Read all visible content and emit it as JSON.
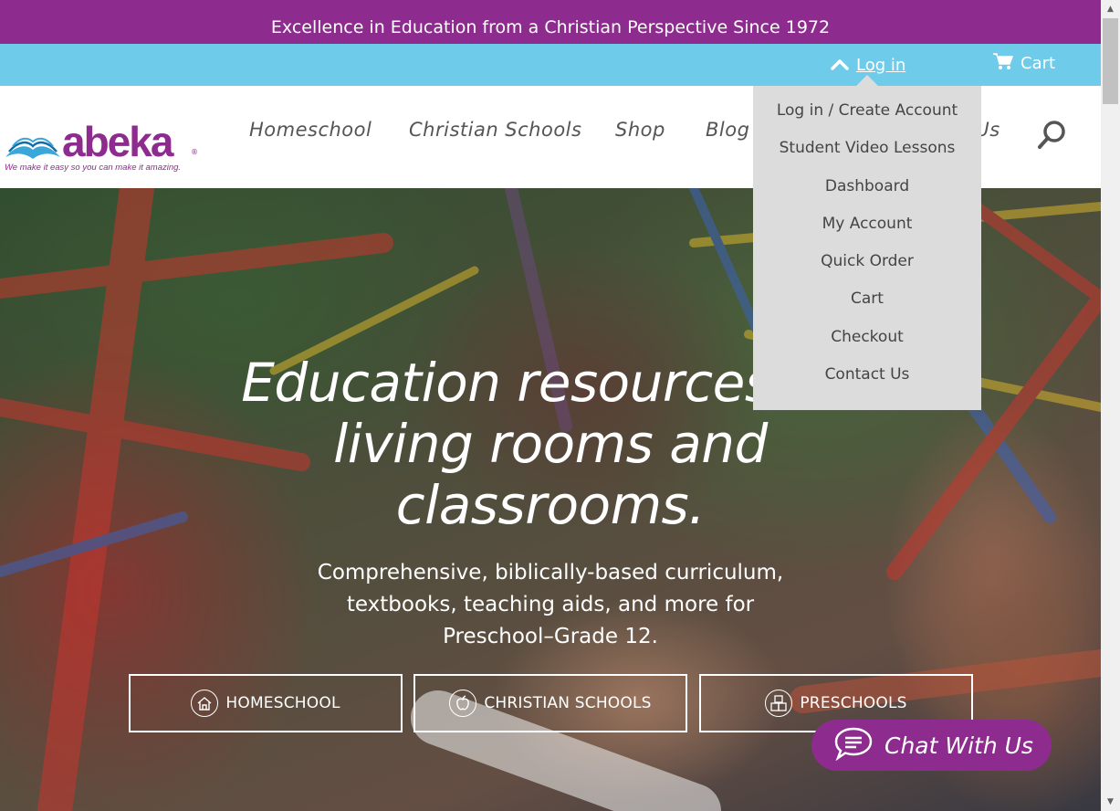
{
  "promo": {
    "text": "Excellence in Education from a Christian Perspective Since 1972"
  },
  "utility": {
    "login_label": "Log in",
    "cart_label": "Cart"
  },
  "logo": {
    "wordmark": "abeka",
    "registered": "®",
    "tagline": "We make it easy so you can make it amazing."
  },
  "nav": {
    "items": [
      {
        "label": "Homeschool"
      },
      {
        "label": "Christian Schools"
      },
      {
        "label": "Shop"
      },
      {
        "label": "Blog"
      },
      {
        "label": "Contact Us"
      }
    ]
  },
  "login_menu": {
    "items": [
      "Log in / Create Account",
      "Student Video Lessons",
      "Dashboard",
      "My Account",
      "Quick Order",
      "Cart",
      "Checkout",
      "Contact Us"
    ]
  },
  "hero": {
    "title_lines": [
      "Education resources for",
      "living rooms and",
      "classrooms."
    ],
    "subtitle_lines": [
      "Comprehensive, biblically-based curriculum,",
      "textbooks, teaching aids, and more for",
      "Preschool–Grade 12."
    ],
    "cta": [
      {
        "label": "HOMESCHOOL",
        "icon": "house-icon"
      },
      {
        "label": "CHRISTIAN SCHOOLS",
        "icon": "apple-icon"
      },
      {
        "label": "PRESCHOOLS",
        "icon": "abc-blocks-icon"
      }
    ]
  },
  "chat": {
    "label": "Chat With Us",
    "icon": "chat-bubble-icon"
  },
  "colors": {
    "brand_purple": "#8e2b8f",
    "utility_blue": "#6ecbea",
    "dropdown_gray": "#dcdcdc",
    "nav_text": "#555555"
  }
}
